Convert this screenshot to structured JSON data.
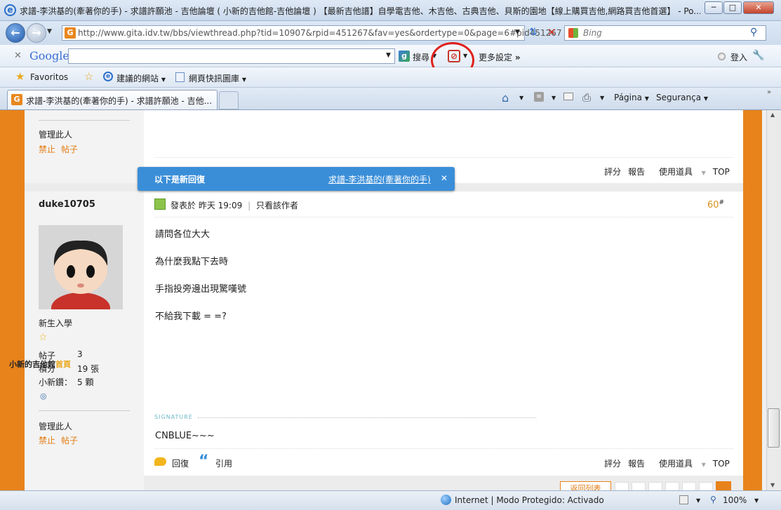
{
  "window": {
    "title": "求譜-李洪基的(牽著你的手) - 求譜許願池 - 吉他論壇 ( 小新的吉他館-吉他論壇 ) 【最新吉他譜】自學電吉他、木吉他、古典吉他、貝斯的園地【線上購買吉他,網路買吉他首選】 - Po...",
    "minimize": "─",
    "restore": "□",
    "close": "✕"
  },
  "address": {
    "url": "http://www.gita.idv.tw/bbs/viewthread.php?tid=10907&rpid=451267&fav=yes&ordertype=0&page=6#pid451267",
    "favicon": "G",
    "search_placeholder": "Bing"
  },
  "googlebar": {
    "logo": "Google",
    "search_label": "搜尋",
    "more_settings": "更多設定",
    "login": "登入"
  },
  "favbar": {
    "favorites": "Favoritos",
    "suggested": "建議的網站",
    "slices": "網頁快訊圖庫"
  },
  "tabs": {
    "active_title": "求譜-李洪基的(牽著你的手) - 求譜許願池 - 吉他...",
    "page_menu": "Página",
    "safety_menu": "Segurança"
  },
  "top_post": {
    "manage": "管理此人",
    "ban": "禁止",
    "posts": "帖子"
  },
  "tooltip": {
    "label": "以下是新回復",
    "link": "求譜-李洪基的(牽著你的手)",
    "close": "✕"
  },
  "actions": {
    "rate": "評分",
    "report": "報告",
    "tools": "使用道具",
    "top": "TOP",
    "reply": "回復",
    "quote": "引用"
  },
  "post": {
    "author": "duke10705",
    "posted_label": "發表於",
    "posted_time": "昨天 19:09",
    "only_author": "只看該作者",
    "floor": "60",
    "floor_mark": "#",
    "lines": [
      "請問各位大大",
      "為什麼我點下去時",
      "手指投旁邊出現驚嘆號",
      "不給我下載 = =?"
    ],
    "signature_label": "SIGNATURE",
    "signature": "CNBLUE~~~"
  },
  "user": {
    "rank": "新生入學",
    "posts_label": "帖子",
    "posts_value": "3",
    "points_label": "積分",
    "points_value": "19 張",
    "coins_label": "小新鑽：",
    "coins_value": "5 顆",
    "manage": "管理此人",
    "ban": "禁止",
    "posts_link": "帖子"
  },
  "overlay": {
    "site_name": "小新的吉他館",
    "home": "首頁"
  },
  "footer": {
    "back_button": "返回列表"
  },
  "status": {
    "zone": "Internet | Modo Protegido: Activado",
    "zoom": "100%"
  },
  "colors": {
    "accent": "#e8831c",
    "tooltip": "#3a8ed8",
    "link": "#e37b10"
  }
}
